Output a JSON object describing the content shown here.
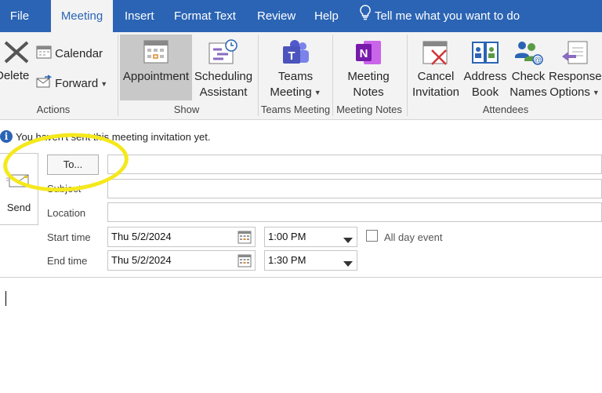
{
  "tabs": [
    "File",
    "Meeting",
    "Insert",
    "Format Text",
    "Review",
    "Help"
  ],
  "tell_me": "Tell me what you want to do",
  "ribbon": {
    "actions": {
      "delete": "Delete",
      "calendar": "Calendar",
      "forward": "Forward",
      "group": "Actions"
    },
    "show": {
      "appointment": "Appointment",
      "scheduling_line1": "Scheduling",
      "scheduling_line2": "Assistant",
      "group": "Show"
    },
    "teams": {
      "line1": "Teams",
      "line2": "Meeting",
      "group": "Teams Meeting"
    },
    "notes": {
      "line1": "Meeting",
      "line2": "Notes",
      "group": "Meeting Notes"
    },
    "attendees": {
      "cancel_line1": "Cancel",
      "cancel_line2": "Invitation",
      "address_line1": "Address",
      "address_line2": "Book",
      "check_line1": "Check",
      "check_line2": "Names",
      "response_line1": "Response",
      "response_line2": "Options",
      "group": "Attendees"
    }
  },
  "info_message": "You haven't sent this meeting invitation yet.",
  "form": {
    "send": "Send",
    "to_button": "To...",
    "subject_label": "Subject",
    "location_label": "Location",
    "start_label": "Start time",
    "end_label": "End time",
    "start_date": "Thu 5/2/2024",
    "start_time": "1:00 PM",
    "end_date": "Thu 5/2/2024",
    "end_time": "1:30 PM",
    "all_day": "All day event",
    "all_day_checked": false
  },
  "colors": {
    "accent": "#2b64b4",
    "highlight": "#f5e81c"
  }
}
